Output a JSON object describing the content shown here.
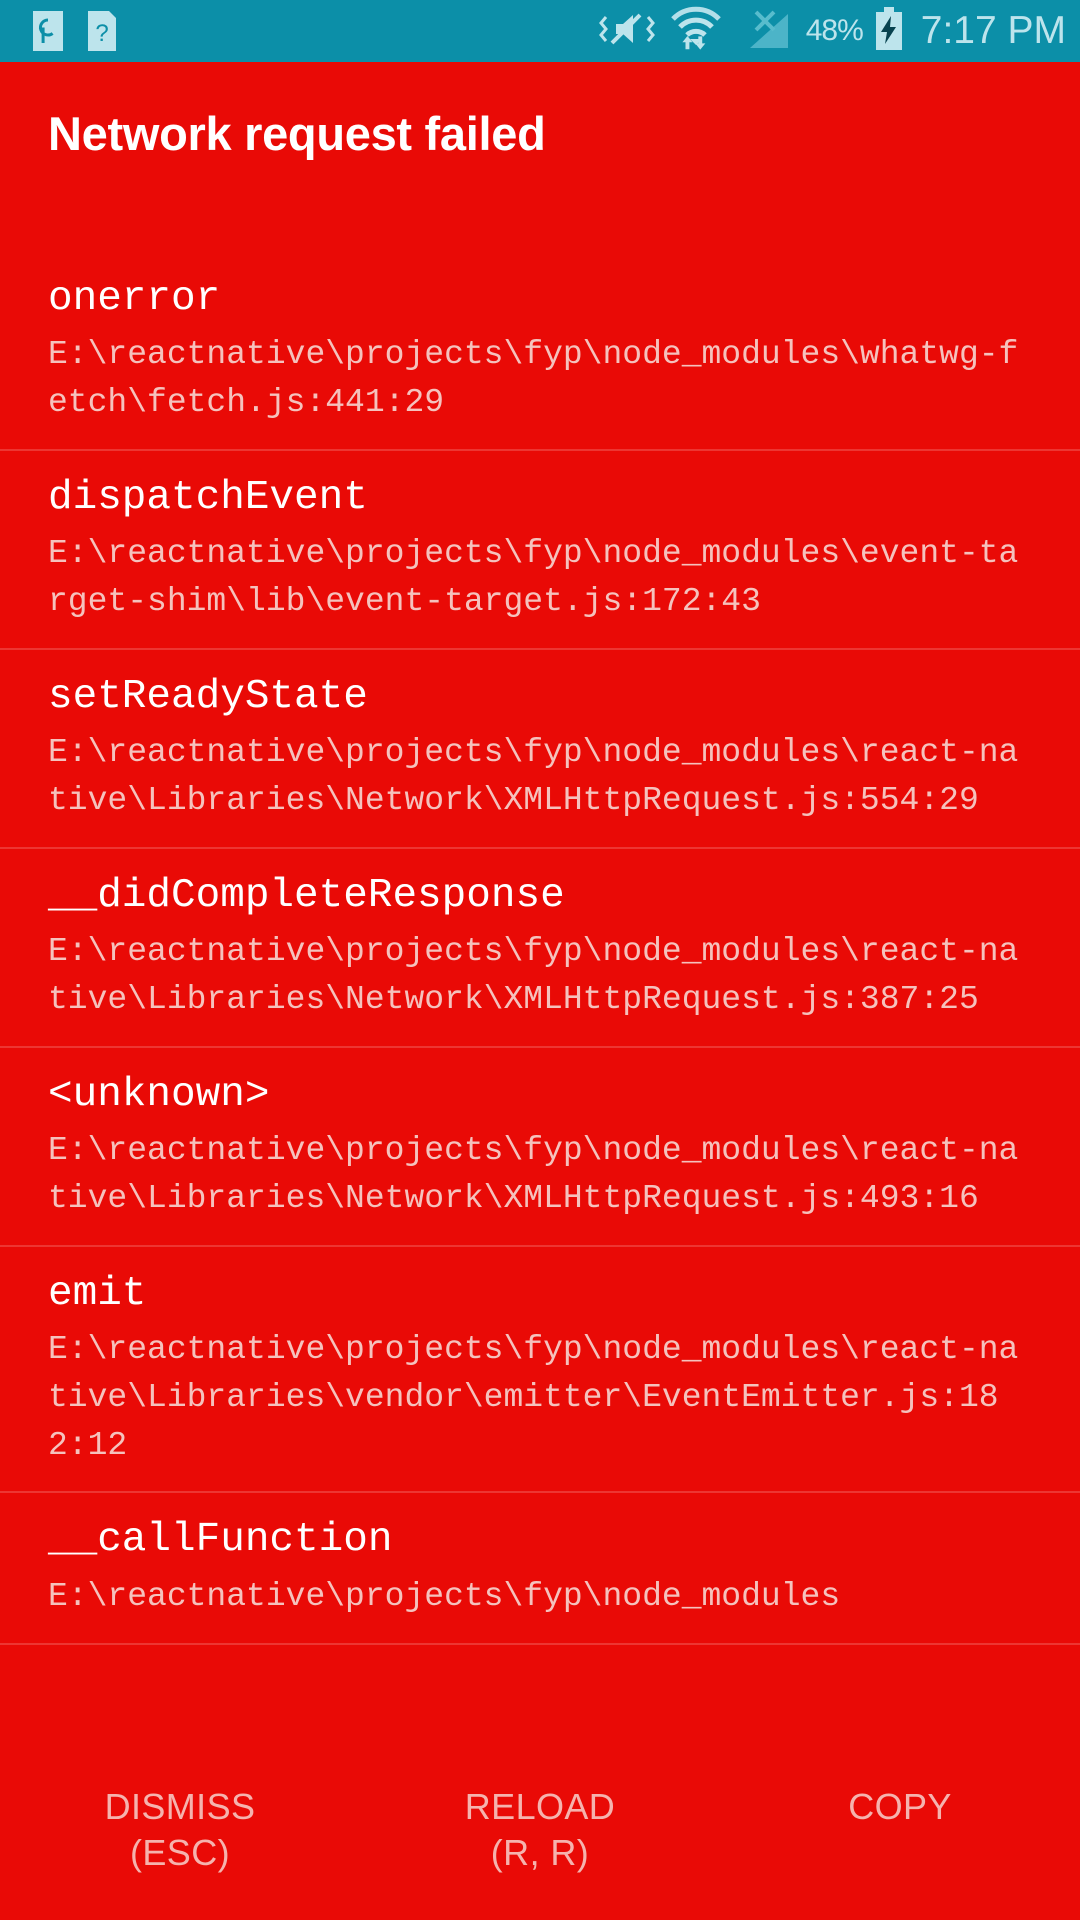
{
  "status_bar": {
    "background_color": "#0c8fa8",
    "icon_color": "#bde4ec",
    "notification_icons": [
      {
        "name": "pocket-casts-notification-icon",
        "glyph": "ρ"
      },
      {
        "name": "unknown-app-notification-icon",
        "glyph": "?"
      }
    ],
    "system_icons": [
      {
        "name": "vibrate-mute-icon"
      },
      {
        "name": "wifi-data-transfer-icon"
      },
      {
        "name": "no-sim-signal-icon"
      }
    ],
    "battery_percent": "48%",
    "battery_charging": true,
    "clock": "7:17 PM"
  },
  "error": {
    "title": "Network request failed",
    "background_color": "#e90a06",
    "title_color": "#ffffff",
    "location_color": "#f5c2bd"
  },
  "stack_frames": [
    {
      "method": "onerror",
      "location": "E:\\reactnative\\projects\\fyp\\node_modules\\whatwg-fetch\\fetch.js:441:29"
    },
    {
      "method": "dispatchEvent",
      "location": "E:\\reactnative\\projects\\fyp\\node_modules\\event-target-shim\\lib\\event-target.js:172:43"
    },
    {
      "method": "setReadyState",
      "location": "E:\\reactnative\\projects\\fyp\\node_modules\\react-native\\Libraries\\Network\\XMLHttpRequest.js:554:29"
    },
    {
      "method": "__didCompleteResponse",
      "location": "E:\\reactnative\\projects\\fyp\\node_modules\\react-native\\Libraries\\Network\\XMLHttpRequest.js:387:25"
    },
    {
      "method": "<unknown>",
      "location": "E:\\reactnative\\projects\\fyp\\node_modules\\react-native\\Libraries\\Network\\XMLHttpRequest.js:493:16"
    },
    {
      "method": "emit",
      "location": "E:\\reactnative\\projects\\fyp\\node_modules\\react-native\\Libraries\\vendor\\emitter\\EventEmitter.js:182:12"
    },
    {
      "method": "__callFunction",
      "location": "E:\\reactnative\\projects\\fyp\\node_modules"
    }
  ],
  "buttons": [
    {
      "name": "dismiss-button",
      "label": "DISMISS",
      "shortcut": "(ESC)"
    },
    {
      "name": "reload-button",
      "label": "RELOAD",
      "shortcut": "(R, R)"
    },
    {
      "name": "copy-button",
      "label": "COPY",
      "shortcut": ""
    }
  ]
}
